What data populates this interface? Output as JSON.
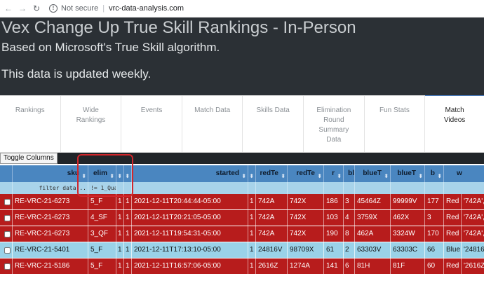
{
  "browser": {
    "back_icon": "back-arrow-icon",
    "forward_icon": "forward-arrow-icon",
    "reload_icon": "reload-icon",
    "security_label": "Not secure",
    "url": "vrc-data-analysis.com"
  },
  "hero": {
    "title": "Vex Change Up True Skill Rankings - In-Person",
    "subtitle": "Based on Microsoft's True Skill algorithm.",
    "note": "This data is updated weekly."
  },
  "tabs": [
    {
      "label": "Rankings"
    },
    {
      "label": "Wide Rankings"
    },
    {
      "label": "Events"
    },
    {
      "label": "Match Data"
    },
    {
      "label": "Skills Data"
    },
    {
      "label": "Elimination Round Summary Data"
    },
    {
      "label": "Fun Stats"
    },
    {
      "label": "Match Videos"
    }
  ],
  "toolbar": {
    "toggle_label": "Toggle Columns"
  },
  "table": {
    "headers": [
      "",
      "sku",
      "elim",
      "",
      "",
      "started",
      "redTe",
      "redTe",
      "r",
      "bl",
      "blueT",
      "blueT",
      "b",
      "w"
    ],
    "filter": {
      "placeholder": "filter data...",
      "elim_value": "!= 1_Qua"
    },
    "rows": [
      {
        "color": "red",
        "cells": [
          "",
          "RE-VRC-21-6273",
          "5_F",
          "1",
          "1",
          "2021-12-11T20:44:44-05:00",
          "1",
          "742A",
          "742X",
          "186",
          "3",
          "45464Z",
          "99999V",
          "177",
          "Red",
          "'742A',"
        ]
      },
      {
        "color": "red",
        "cells": [
          "",
          "RE-VRC-21-6273",
          "4_SF",
          "1",
          "1",
          "2021-12-11T20:21:05-05:00",
          "1",
          "742A",
          "742X",
          "103",
          "4",
          "3759X",
          "462X",
          "3",
          "Red",
          "'742A',"
        ]
      },
      {
        "color": "red",
        "cells": [
          "",
          "RE-VRC-21-6273",
          "3_QF",
          "1",
          "1",
          "2021-12-11T19:54:31-05:00",
          "1",
          "742A",
          "742X",
          "190",
          "8",
          "462A",
          "3324W",
          "170",
          "Red",
          "'742A',"
        ]
      },
      {
        "color": "blue",
        "cells": [
          "",
          "RE-VRC-21-5401",
          "5_F",
          "1",
          "1",
          "2021-12-11T17:13:10-05:00",
          "1",
          "24816V",
          "98709X",
          "61",
          "2",
          "63303V",
          "63303C",
          "66",
          "Blue",
          "'24816"
        ]
      },
      {
        "color": "red",
        "cells": [
          "",
          "RE-VRC-21-5186",
          "5_F",
          "1",
          "1",
          "2021-12-11T16:57:06-05:00",
          "1",
          "2616Z",
          "1274A",
          "141",
          "6",
          "81H",
          "81F",
          "60",
          "Red",
          "'2616Z"
        ]
      }
    ]
  },
  "colors": {
    "hero_bg": "#2b3035",
    "header_blue": "#4a86c0",
    "row_red": "#b71c1c",
    "row_blue": "#9ad2e8",
    "annotation": "#d2262b"
  }
}
